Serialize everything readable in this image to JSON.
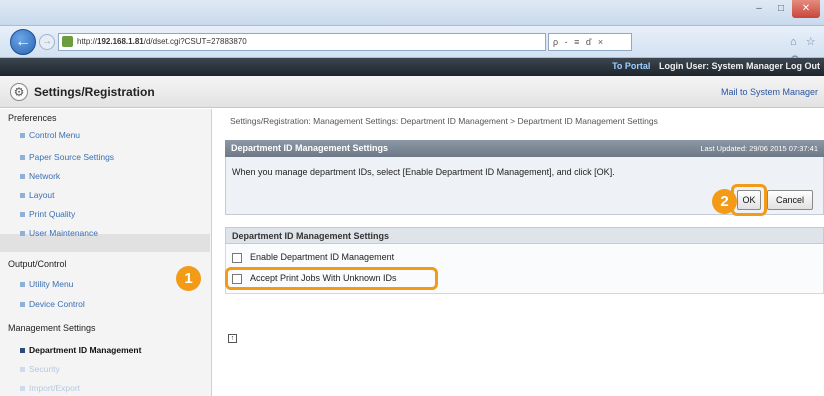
{
  "browser": {
    "url_prefix": "http://",
    "url_host": "192.168.1.81",
    "url_path": "/d/dset.cgi?CSUT=27883870",
    "address_tools": "ρ - ≡ ď ×",
    "right_icons": "⌂ ☆ ⚙"
  },
  "header": {
    "portal": "To Portal",
    "login_user": "Login User: System Manager",
    "logout": "Log Out",
    "page_title": "Settings/Registration",
    "mail": "Mail to System Manager"
  },
  "sidebar": {
    "preferences": "Preferences",
    "preferences_items": [
      "Control Menu",
      "Paper Source Settings",
      "Network",
      "Layout",
      "Print Quality",
      "User Maintenance"
    ],
    "output": "Output/Control",
    "output_items": [
      "Utility Menu",
      "Device Control"
    ],
    "management": "Management Settings",
    "management_items": [
      "Department ID Management",
      "Security",
      "Import/Export"
    ]
  },
  "main": {
    "breadcrumb": "Settings/Registration: Management Settings: Department ID Management > Department ID Management Settings",
    "panel_title": "Department ID Management Settings",
    "last_updated": "Last Updated: 29/06 2015 07:37:41",
    "message": "When you manage department IDs, select [Enable Department ID Management], and click [OK].",
    "ok": "OK",
    "cancel": "Cancel",
    "section_title": "Department ID Management Settings",
    "checkbox_1": "Enable Department ID Management",
    "checkbox_2": "Accept Print Jobs With Unknown IDs",
    "top_link": "↑"
  },
  "callouts": {
    "one": "1",
    "two": "2"
  },
  "colors": {
    "accent": "#f39a17",
    "header_dark": "#1e252c",
    "link": "#3a6fb5"
  }
}
